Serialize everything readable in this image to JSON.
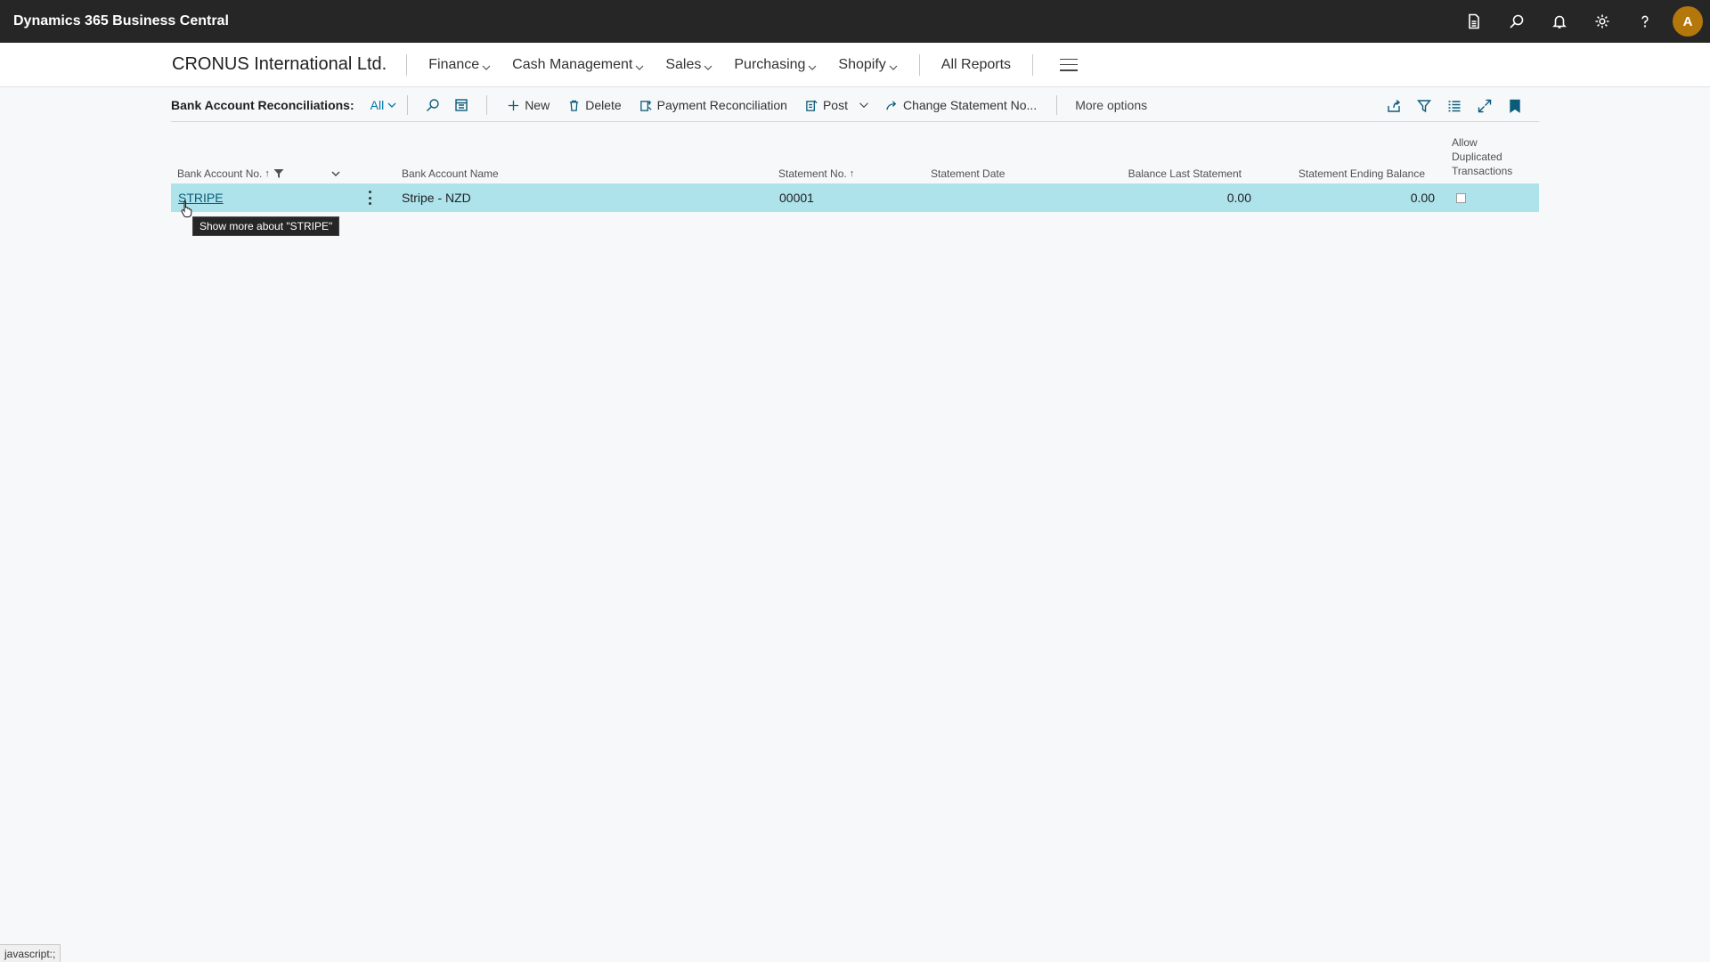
{
  "topbar": {
    "app_title": "Dynamics 365 Business Central",
    "avatar_initial": "A",
    "icons": [
      "document-icon",
      "search-icon",
      "bell-icon",
      "gear-icon",
      "help-icon"
    ]
  },
  "navbar": {
    "company": "CRONUS International Ltd.",
    "menus": [
      "Finance",
      "Cash Management",
      "Sales",
      "Purchasing",
      "Shopify"
    ],
    "all_reports": "All Reports"
  },
  "actionbar": {
    "caption": "Bank Account Reconciliations:",
    "view": "All",
    "new_label": "New",
    "delete_label": "Delete",
    "payment_rec_label": "Payment Reconciliation",
    "post_label": "Post",
    "change_statement_label": "Change Statement No...",
    "more_options_label": "More options"
  },
  "grid": {
    "headers": {
      "bank_account_no": "Bank Account No.",
      "bank_account_name": "Bank Account Name",
      "statement_no": "Statement No.",
      "statement_date": "Statement Date",
      "balance_last_statement": "Balance Last Statement",
      "statement_ending_balance": "Statement Ending Balance",
      "allow_dup_1": "Allow",
      "allow_dup_2": "Duplicated",
      "allow_dup_3": "Transactions"
    },
    "rows": [
      {
        "bank_account_no": "STRIPE",
        "bank_account_name": "Stripe - NZD",
        "statement_no": "00001",
        "statement_date": "",
        "balance_last_statement": "0.00",
        "statement_ending_balance": "0.00",
        "allow_duplicated": false
      }
    ]
  },
  "tooltip": "Show more about \"STRIPE\"",
  "statusbar": "javascript:;"
}
